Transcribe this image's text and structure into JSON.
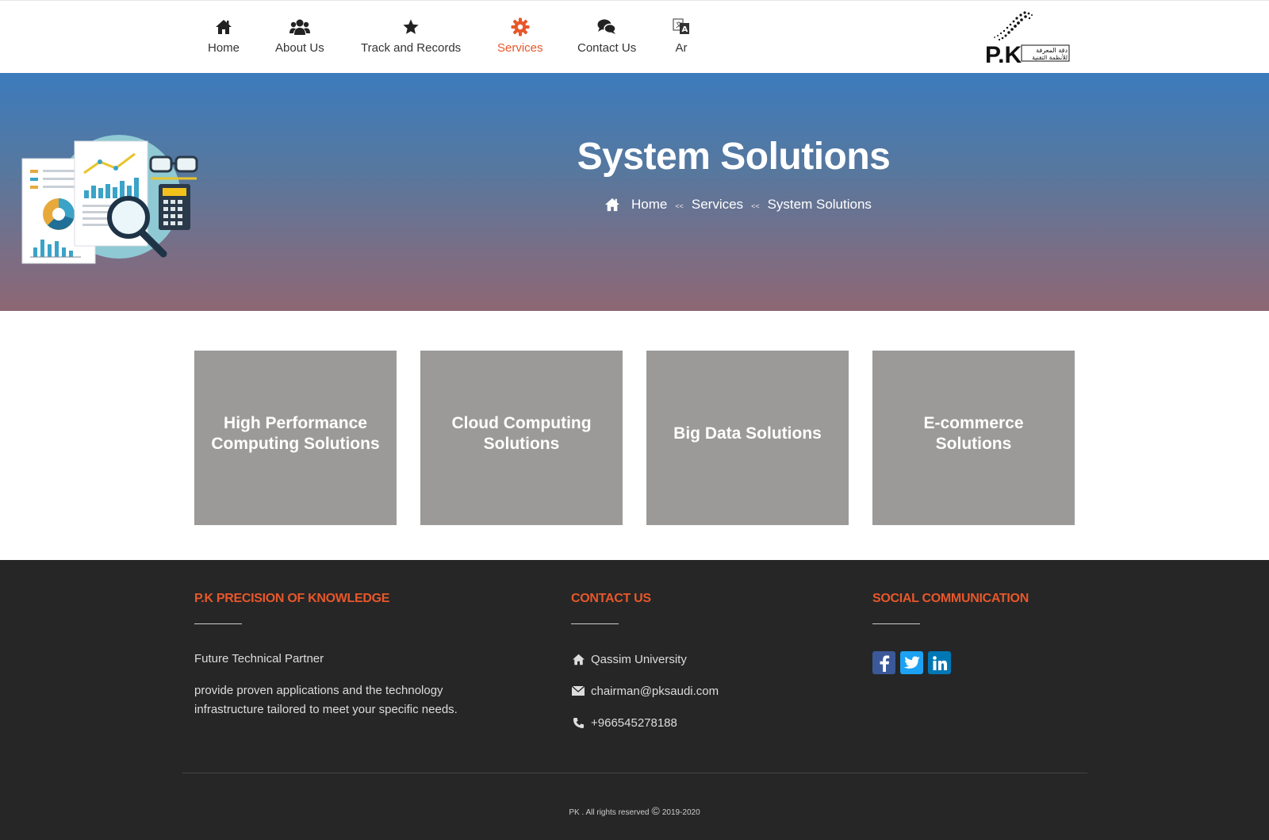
{
  "nav": {
    "items": [
      {
        "label": "Home",
        "icon": "home-icon"
      },
      {
        "label": "About Us",
        "icon": "users-icon"
      },
      {
        "label": "Track and Records",
        "icon": "star-icon"
      },
      {
        "label": "Services",
        "icon": "gear-icon",
        "active": true
      },
      {
        "label": "Contact Us",
        "icon": "comments-icon"
      },
      {
        "label": "Ar",
        "icon": "language-icon"
      }
    ],
    "logo_text": "P.K",
    "logo_arabic": "دقة المعرفة للأنظمة التقنية",
    "active_color": "#e8572a"
  },
  "hero": {
    "title": "System Solutions",
    "breadcrumb": [
      {
        "label": "Home"
      },
      {
        "label": "Services"
      },
      {
        "label": "System Solutions"
      }
    ],
    "separator": "<<"
  },
  "cards": [
    {
      "label": "High Performance Computing Solutions"
    },
    {
      "label": "Cloud Computing Solutions"
    },
    {
      "label": "Big Data Solutions"
    },
    {
      "label": "E-commerce Solutions"
    }
  ],
  "footer": {
    "about": {
      "heading": "P.K PRECISION OF KNOWLEDGE",
      "tagline": "Future Technical Partner",
      "description": "provide proven applications and the technology infrastructure tailored to meet your specific needs."
    },
    "contact": {
      "heading": "CONTACT US",
      "address": "Qassim University",
      "email": "chairman@pksaudi.com",
      "phone": "+966545278188"
    },
    "social": {
      "heading": "SOCIAL COMMUNICATION",
      "links": [
        {
          "icon": "facebook-icon",
          "color": "#3b5998"
        },
        {
          "icon": "twitter-icon",
          "color": "#1da1f2"
        },
        {
          "icon": "linkedin-icon",
          "color": "#0077b5"
        }
      ]
    },
    "copyright_prefix": "PK . All rights reserved",
    "copyright_symbol": "©",
    "copyright_years": "2019-2020"
  }
}
